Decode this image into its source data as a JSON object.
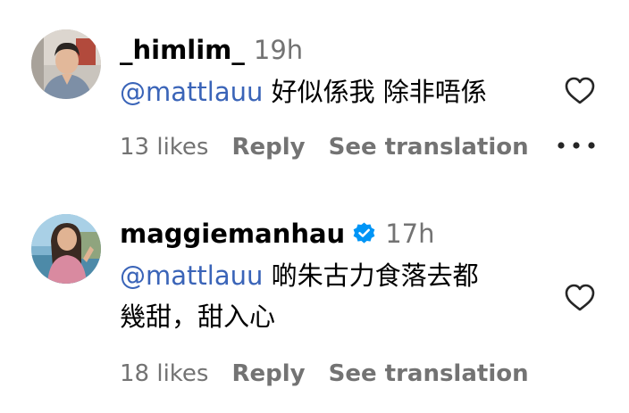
{
  "comments": [
    {
      "username": "_himlim_",
      "time": "19h",
      "mention": "@mattlauu",
      "text_lines": [
        " 好似係我 除非唔係"
      ],
      "likes": "13 likes",
      "reply": "Reply",
      "translate": "See translation",
      "verified": false
    },
    {
      "username": "maggiemanhau",
      "time": "17h",
      "mention": "@mattlauu",
      "text_lines": [
        " 啲朱古力食落去都",
        "幾甜，甜入心"
      ],
      "likes": "18 likes",
      "reply": "Reply",
      "translate": "See translation",
      "verified": true
    }
  ],
  "colors": {
    "text": "#000000",
    "secondary": "#737373",
    "mention": "#3a64b8",
    "verified": "#0095f6"
  },
  "icons": [
    "heart-icon",
    "more-icon",
    "verified-badge-icon"
  ]
}
